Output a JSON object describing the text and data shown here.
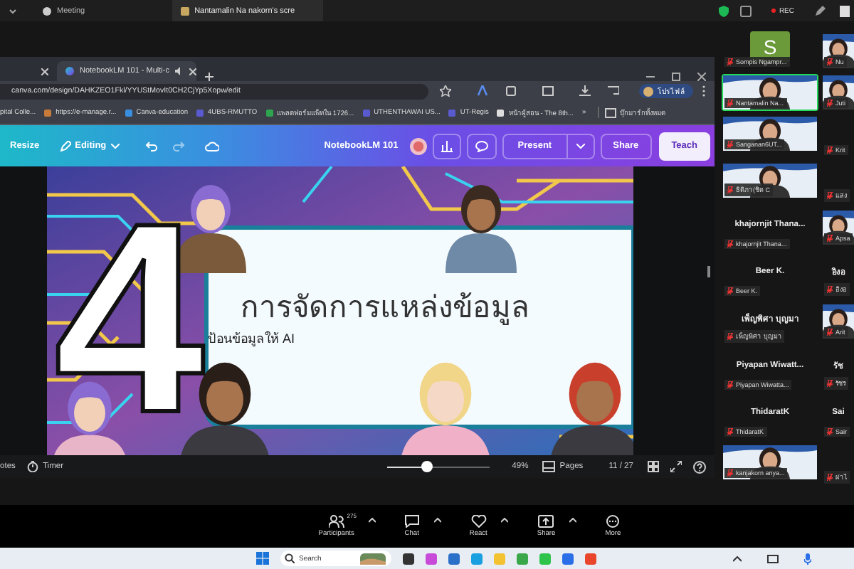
{
  "meeting_bar": {
    "tabs": [
      {
        "label": "Meeting",
        "selected": false
      },
      {
        "label": "Nantamalin Na nakorn's scre",
        "selected": true
      }
    ],
    "recording": "REC"
  },
  "browser": {
    "tabs": [
      {
        "selected": false
      },
      {
        "label": "NotebookLM 101 - Multi-c",
        "selected": true
      }
    ],
    "address": "canva.com/design/DAHKZEO1Fkl/YYUStMovIt0CH2CjYp5Xopw/edit",
    "profile": "โปรไฟล์",
    "bookmarks": [
      "pital Colle...",
      "https://e-manage.r...",
      "Canva-education",
      "4UBS-RMUTTO",
      "แพลตฟอร์มแพ็ทใน 1726...",
      "UTHENTHAWAI US...",
      "UT-Regis",
      "หน้าผู้สอน - The 8th..."
    ],
    "bookmarks_more": "»",
    "all_bookmarks": "บุ๊กมาร์กทั้งหมด"
  },
  "canva": {
    "resize": "Resize",
    "editing": "Editing",
    "title": "NotebookLM 101",
    "present": "Present",
    "share": "Share",
    "teach": "Teach"
  },
  "slide": {
    "number": "4",
    "title": "การจัดการแหล่งข้อมูล",
    "subtitle": "ป้อนข้อมูลให้ AI"
  },
  "editor_footer": {
    "notes": "otes",
    "timer": "Timer",
    "zoom": {
      "level": 0.4,
      "reading": "49%"
    },
    "pages": "Pages",
    "page_count": "11 / 27"
  },
  "participants": [
    {
      "kind": "avatar",
      "initial": "S",
      "color": "#6a9a3a",
      "label": "Sompis Ngampr...",
      "speaking": false
    },
    {
      "kind": "video",
      "label": "Nu",
      "speaking": false
    },
    {
      "kind": "video",
      "label": "Nantamalin Na...",
      "speaking": true
    },
    {
      "kind": "video",
      "label": "Juti",
      "speaking": false
    },
    {
      "kind": "video",
      "label": "Sanganan6UT...",
      "speaking": false
    },
    {
      "kind": "name",
      "label": "Krit",
      "speaking": false
    },
    {
      "kind": "video",
      "label": "ธิติภา(ชิต C",
      "speaking": false
    },
    {
      "kind": "name",
      "label": "แสง",
      "speaking": false
    },
    {
      "kind": "name",
      "name": "khajornjit  Thana...",
      "label": "khajornjit Thana...",
      "speaking": false
    },
    {
      "kind": "video",
      "label": "Apsa",
      "speaking": false
    },
    {
      "kind": "name",
      "name": "Beer K.",
      "label": "Beer K.",
      "speaking": false
    },
    {
      "kind": "name",
      "name": "อิงอ",
      "label": "อิงอ",
      "speaking": false
    },
    {
      "kind": "name",
      "name": "เพ็ญพิศา บุญมา",
      "label": "เพ็ญพิศา บุญมา",
      "speaking": false
    },
    {
      "kind": "video",
      "label": "Arit",
      "speaking": false
    },
    {
      "kind": "name",
      "name": "Piyapan  Wiwatt...",
      "label": "Piyapan Wiwatta...",
      "speaking": false
    },
    {
      "kind": "name",
      "name": "รัช",
      "label": "รัชร",
      "speaking": false
    },
    {
      "kind": "name",
      "name": "ThidaratK",
      "label": "ThidaratK",
      "speaking": false
    },
    {
      "kind": "name",
      "name": "Sai",
      "label": "Sair",
      "speaking": false
    },
    {
      "kind": "video",
      "label": "kanjakorn anya...",
      "speaking": false
    },
    {
      "kind": "name",
      "label": "ผ่าไ",
      "speaking": false
    }
  ],
  "meeting_toolbar": [
    {
      "kind": "participants",
      "label": "Participants",
      "count": "275"
    },
    {
      "kind": "chat",
      "label": "Chat"
    },
    {
      "kind": "react",
      "label": "React"
    },
    {
      "kind": "share",
      "label": "Share"
    },
    {
      "kind": "more",
      "label": "More"
    }
  ],
  "taskbar": {
    "search": {
      "placeholder": "Search"
    }
  }
}
